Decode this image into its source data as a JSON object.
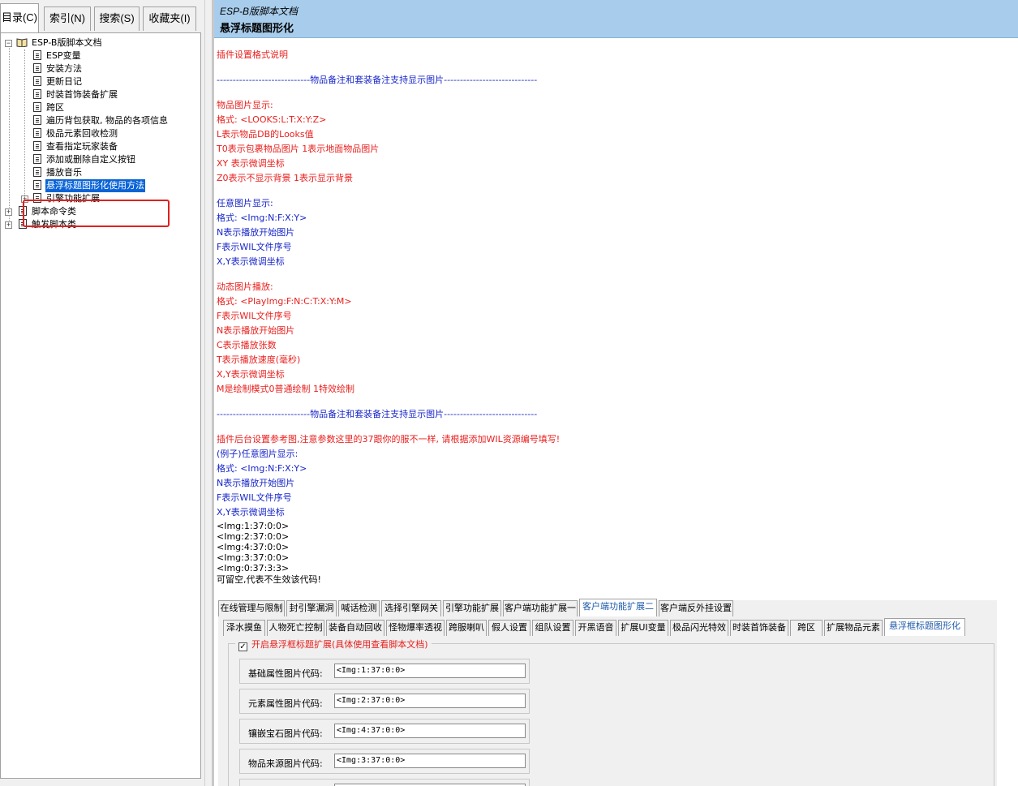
{
  "nav_tabs": [
    {
      "label": "目录(C)"
    },
    {
      "label": "索引(N)"
    },
    {
      "label": "搜索(S)"
    },
    {
      "label": "收藏夹(I)"
    }
  ],
  "tree": {
    "root": "ESP-B版脚本文档",
    "children": [
      "ESP变量",
      "安装方法",
      "更新日记",
      "时装首饰装备扩展",
      "跨区",
      "遍历背包获取, 物品的各项信息",
      "极品元素回收检测",
      "查看指定玩家装备",
      "添加或删除自定义按钮",
      "播放音乐",
      "悬浮标题图形化使用方法",
      "引擎功能扩展"
    ],
    "top_level": [
      "脚本命令类",
      "触发脚本类"
    ]
  },
  "header": {
    "subtitle": "ESP-B版脚本文档",
    "title": "悬浮标题图形化"
  },
  "content": {
    "lines": [
      {
        "text": "插件设置格式说明",
        "color": "red"
      },
      {
        "text": "-----------------------------物品备注和套装备注支持显示图片-----------------------------",
        "color": "blue"
      },
      {
        "text": "物品图片显示:",
        "color": "red"
      },
      {
        "text": "格式: <LOOKS:L:T:X:Y:Z>",
        "color": "red"
      },
      {
        "text": "L表示物品DB的Looks值",
        "color": "red"
      },
      {
        "text": "T0表示包裹物品图片 1表示地面物品图片",
        "color": "red"
      },
      {
        "text": "XY 表示微调坐标",
        "color": "red"
      },
      {
        "text": "Z0表示不显示背景 1表示显示背景",
        "color": "red"
      },
      {
        "text": "任意图片显示:",
        "color": "blue"
      },
      {
        "text": "格式: <Img:N:F:X:Y>",
        "color": "blue"
      },
      {
        "text": "N表示播放开始图片",
        "color": "blue"
      },
      {
        "text": "F表示WIL文件序号",
        "color": "blue"
      },
      {
        "text": "X,Y表示微调坐标",
        "color": "blue"
      },
      {
        "text": "动态图片播放:",
        "color": "red"
      },
      {
        "text": "格式: <PlayImg:F:N:C:T:X:Y:M>",
        "color": "red"
      },
      {
        "text": "F表示WIL文件序号",
        "color": "red"
      },
      {
        "text": "N表示播放开始图片",
        "color": "red"
      },
      {
        "text": "C表示播放张数",
        "color": "red"
      },
      {
        "text": "T表示播放速度(毫秒)",
        "color": "red"
      },
      {
        "text": "X,Y表示微调坐标",
        "color": "red"
      },
      {
        "text": "M是绘制模式0普通绘制 1特效绘制",
        "color": "red"
      },
      {
        "text": "-----------------------------物品备注和套装备注支持显示图片-----------------------------",
        "color": "blue"
      },
      {
        "text": "插件后台设置参考图,注意参数这里的37跟你的服不一样, 请根据添加WIL资源编号填写!",
        "color": "red"
      },
      {
        "text": "(例子)任意图片显示:",
        "color": "blue"
      },
      {
        "text": "格式: <Img:N:F:X:Y>",
        "color": "blue"
      },
      {
        "text": "N表示播放开始图片",
        "color": "blue"
      },
      {
        "text": "F表示WIL文件序号",
        "color": "blue"
      },
      {
        "text": "X,Y表示微调坐标",
        "color": "blue"
      },
      {
        "text": "<Img:1:37:0:0>",
        "color": "black"
      },
      {
        "text": "<Img:2:37:0:0>",
        "color": "black"
      },
      {
        "text": "<Img:4:37:0:0>",
        "color": "black"
      },
      {
        "text": "<Img:3:37:0:0>",
        "color": "black"
      },
      {
        "text": "<Img:0:37:3:3>",
        "color": "black"
      },
      {
        "text": "可留空,代表不生效该代码!",
        "color": "black"
      }
    ]
  },
  "config": {
    "tabs_row1": [
      "在线管理与限制",
      "封引擎漏洞",
      "喊话检测",
      "选择引擎网关",
      "引擎功能扩展",
      "客户端功能扩展一",
      "客户端功能扩展二",
      "客户端反外挂设置"
    ],
    "tabs_row2": [
      "泽水摸鱼",
      "人物死亡控制",
      "装备自动回收",
      "怪物爆率透视",
      "跨服喇叭",
      "假人设置",
      "组队设置",
      "开黑语音",
      "扩展UI变量",
      "极品闪光特效",
      "时装首饰装备",
      "跨区",
      "扩展物品元素",
      "悬浮框标题图形化"
    ],
    "group_caption": "开启悬浮框标题扩展(具体使用查看脚本文档)",
    "checkbox_mark": "✓",
    "fields": [
      {
        "label": "基础属性图片代码:",
        "value": "<Img:1:37:0:0>"
      },
      {
        "label": "元素属性图片代码:",
        "value": "<Img:2:37:0:0>"
      },
      {
        "label": "镶嵌宝石图片代码:",
        "value": "<Img:4:37:0:0>"
      },
      {
        "label": "物品来源图片代码:",
        "value": "<Img:3:37:0:0>"
      }
    ]
  }
}
